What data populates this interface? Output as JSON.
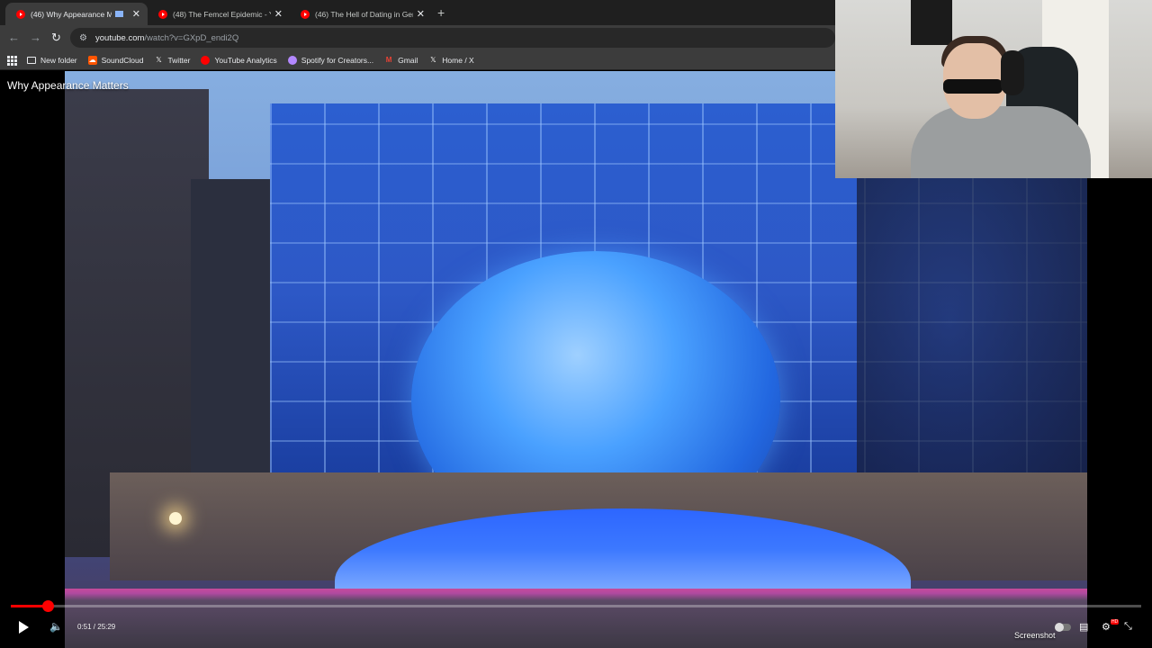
{
  "tabs": [
    {
      "label": "(46) Why Appearance Matte",
      "active": true
    },
    {
      "label": "(48) The Femcel Epidemic - You",
      "active": false
    },
    {
      "label": "(46) The Hell of Dating in Gen Z",
      "active": false
    }
  ],
  "address": {
    "host": "youtube.com",
    "path": "/watch?v=GXpD_endi2Q"
  },
  "bookmarks": [
    {
      "label": "New folder",
      "icon": "folder-icon"
    },
    {
      "label": "SoundCloud",
      "icon": "soundcloud-icon"
    },
    {
      "label": "Twitter",
      "icon": "x-icon"
    },
    {
      "label": "YouTube Analytics",
      "icon": "youtube-icon"
    },
    {
      "label": "Spotify for Creators...",
      "icon": "spotify-icon"
    },
    {
      "label": "Gmail",
      "icon": "gmail-icon"
    },
    {
      "label": "Home / X",
      "icon": "x-icon"
    }
  ],
  "video": {
    "title": "Why Appearance Matters",
    "time": "0:51 / 25:29",
    "progress": 0.033,
    "overlay_label": "Screenshot"
  },
  "colors": {
    "accent": "#ff0000",
    "chrome_bg": "#3c3c3c"
  }
}
